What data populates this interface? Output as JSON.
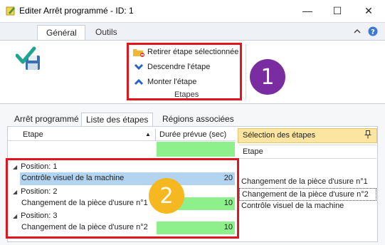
{
  "window": {
    "title": "Editer Arrêt programmé - ID: 1",
    "minimize": "—",
    "maximize": "☐",
    "close": "✕"
  },
  "ribbon": {
    "tabs": [
      "Général",
      "Outils"
    ],
    "actions": [
      {
        "label": "Retirer étape sélectionnée",
        "icon": "folder-remove-icon"
      },
      {
        "label": "Descendre l'étape",
        "icon": "chevron-down-icon"
      },
      {
        "label": "Monter l'étape",
        "icon": "chevron-up-icon"
      }
    ],
    "group_label": "Etapes"
  },
  "content_tabs": [
    "Arrêt programmé",
    "Liste des étapes",
    "Régions associées"
  ],
  "steps_grid": {
    "columns": [
      "Etape",
      "Durée prévue (sec)"
    ],
    "groups": [
      {
        "label": "Position: 1",
        "row": {
          "name": "Contrôle visuel de la machine",
          "duration": "20"
        }
      },
      {
        "label": "Position: 2",
        "row": {
          "name": "Changement de la pièce d'usure n°1",
          "duration": "10"
        }
      },
      {
        "label": "Position: 3",
        "row": {
          "name": "Changement de la pièce d'usure n°2",
          "duration": "10"
        }
      }
    ]
  },
  "selection_panel": {
    "title": "Sélection des étapes",
    "column": "Etape",
    "items": [
      "Changement de la pièce d'usure n°1",
      "Changement de la pièce d'usure n°2",
      "Contrôle visuel de la machine"
    ]
  },
  "callouts": [
    "1",
    "2"
  ],
  "colors": {
    "callout_1": "#7a2da0",
    "callout_2": "#f5b820",
    "highlight_box": "#e0161f",
    "duration_fill": "#8ef08a",
    "selected_row": "#b3d4f0",
    "panel_header": "#fce5a1"
  }
}
